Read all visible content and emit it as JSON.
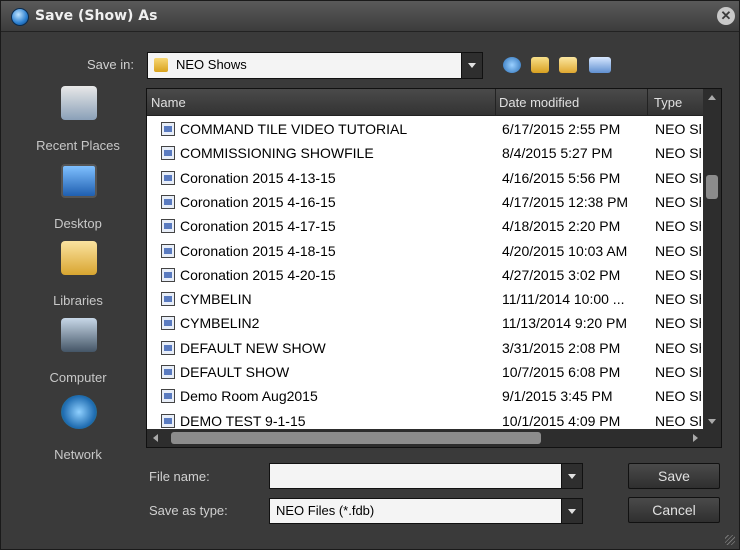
{
  "window": {
    "title": "Save (Show) As",
    "close_glyph": "✕"
  },
  "save_in": {
    "label": "Save in:",
    "value": "NEO Shows"
  },
  "toolbar": {
    "icons": [
      "back-icon",
      "up-folder-icon",
      "new-folder-icon",
      "views-menu-icon"
    ]
  },
  "places": [
    {
      "label": "Recent Places",
      "icon": "recent-places-icon"
    },
    {
      "label": "Desktop",
      "icon": "desktop-icon"
    },
    {
      "label": "Libraries",
      "icon": "libraries-icon"
    },
    {
      "label": "Computer",
      "icon": "computer-icon"
    },
    {
      "label": "Network",
      "icon": "network-icon"
    }
  ],
  "columns": {
    "name": "Name",
    "date": "Date modified",
    "type": "Type"
  },
  "files": [
    {
      "name": "COMMAND TILE VIDEO TUTORIAL",
      "date": "6/17/2015 2:55 PM",
      "type": "NEO Sh"
    },
    {
      "name": "COMMISSIONING SHOWFILE",
      "date": "8/4/2015 5:27 PM",
      "type": "NEO Sh"
    },
    {
      "name": "Coronation 2015 4-13-15",
      "date": "4/16/2015 5:56 PM",
      "type": "NEO Sh"
    },
    {
      "name": "Coronation 2015 4-16-15",
      "date": "4/17/2015 12:38 PM",
      "type": "NEO Sh"
    },
    {
      "name": "Coronation 2015 4-17-15",
      "date": "4/18/2015 2:20 PM",
      "type": "NEO Sh"
    },
    {
      "name": "Coronation 2015 4-18-15",
      "date": "4/20/2015 10:03 AM",
      "type": "NEO Sh"
    },
    {
      "name": "Coronation 2015 4-20-15",
      "date": "4/27/2015 3:02 PM",
      "type": "NEO Sh"
    },
    {
      "name": "CYMBELIN",
      "date": "11/11/2014 10:00 ...",
      "type": "NEO Sh"
    },
    {
      "name": "CYMBELIN2",
      "date": "11/13/2014 9:20 PM",
      "type": "NEO Sh"
    },
    {
      "name": "DEFAULT NEW SHOW",
      "date": "3/31/2015 2:08 PM",
      "type": "NEO Sh"
    },
    {
      "name": "DEFAULT SHOW",
      "date": "10/7/2015 6:08 PM",
      "type": "NEO Sh"
    },
    {
      "name": "Demo Room Aug2015",
      "date": "9/1/2015 3:45 PM",
      "type": "NEO Sh"
    },
    {
      "name": "DEMO TEST 9-1-15",
      "date": "10/1/2015 4:09 PM",
      "type": "NEO Sh"
    }
  ],
  "file_name": {
    "label": "File name:",
    "value": ""
  },
  "save_as_type": {
    "label": "Save as type:",
    "value": "NEO Files (*.fdb)"
  },
  "buttons": {
    "save": "Save",
    "cancel": "Cancel"
  }
}
